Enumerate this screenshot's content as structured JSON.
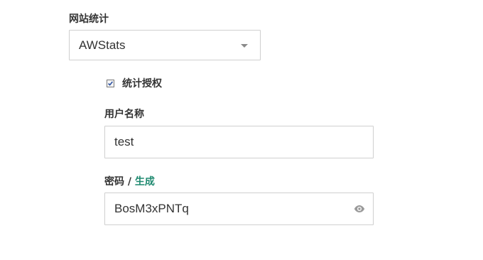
{
  "stats": {
    "label": "网站统计",
    "selected": "AWStats"
  },
  "auth": {
    "checkbox_label": "统计授权",
    "checked": true
  },
  "username": {
    "label": "用户名称",
    "value": "test"
  },
  "password": {
    "label": "密码",
    "separator": "/",
    "generate_link": "生成",
    "value": "BosM3xPNTq"
  },
  "icons": {
    "dropdown": "chevron-down-icon",
    "checkbox": "check-icon",
    "visibility": "eye-icon"
  },
  "colors": {
    "link": "#1f8a70",
    "border": "#cfcfcf",
    "text": "#333333"
  }
}
